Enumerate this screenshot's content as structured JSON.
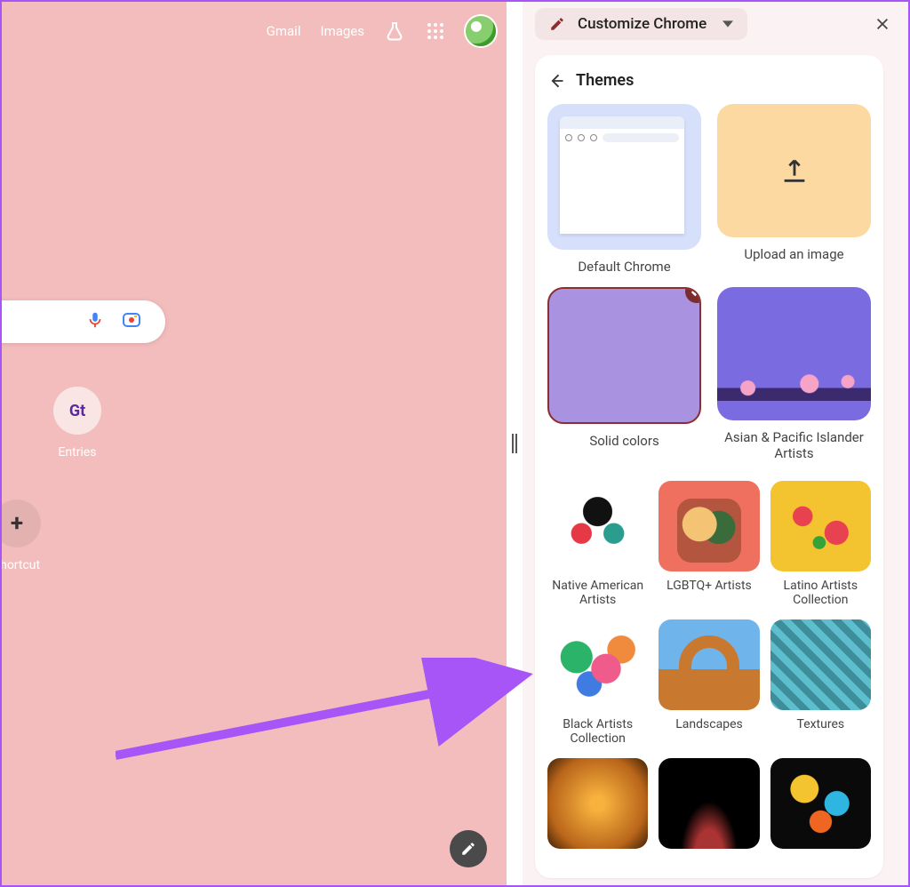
{
  "ntp": {
    "header": {
      "gmail": "Gmail",
      "images": "Images"
    },
    "shortcuts": {
      "entries": {
        "label": "Entries",
        "badge": "Gt"
      },
      "add": {
        "label": "shortcut",
        "glyph": "+"
      }
    }
  },
  "panel": {
    "title": "Customize Chrome",
    "section_title": "Themes",
    "primary": [
      {
        "key": "default",
        "label": "Default Chrome"
      },
      {
        "key": "upload",
        "label": "Upload an image"
      },
      {
        "key": "solid",
        "label": "Solid colors",
        "selected": true
      },
      {
        "key": "asian",
        "label": "Asian & Pacific Islander Artists"
      }
    ],
    "collections": [
      {
        "key": "native",
        "label": "Native American Artists"
      },
      {
        "key": "lgbtq",
        "label": "LGBTQ+ Artists"
      },
      {
        "key": "latino",
        "label": "Latino Artists Collection"
      },
      {
        "key": "black",
        "label": "Black Artists Collection"
      },
      {
        "key": "land",
        "label": "Landscapes"
      },
      {
        "key": "tex",
        "label": "Textures"
      },
      {
        "key": "r7",
        "label": ""
      },
      {
        "key": "r8",
        "label": ""
      },
      {
        "key": "r9",
        "label": ""
      }
    ]
  },
  "colors": {
    "pink_bg": "#f3bdbd",
    "panel_bg": "#fbf3f3",
    "accent": "#8d2d2d",
    "annotation": "#a855f7"
  }
}
